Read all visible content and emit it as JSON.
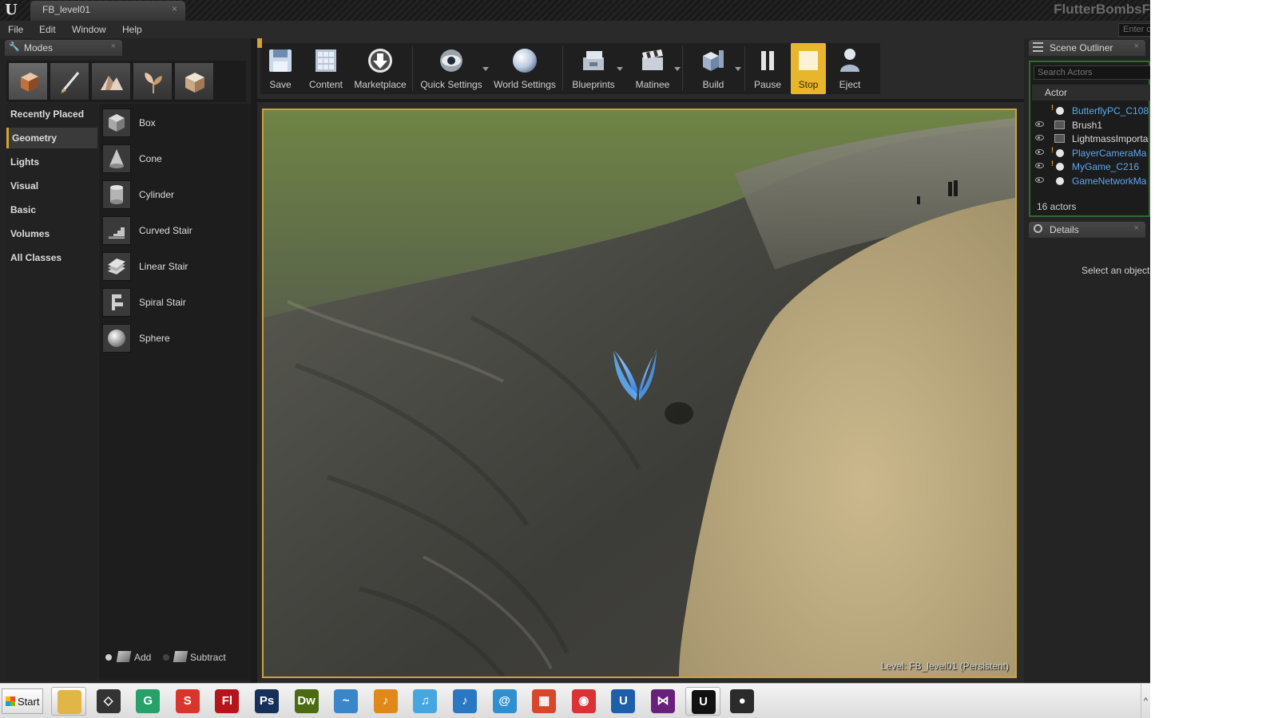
{
  "window": {
    "tab_title": "FB_level01",
    "tab_close": "×",
    "project_name": "FlutterBombsF",
    "help_search_placeholder": "Enter c"
  },
  "menubar": {
    "items": [
      "File",
      "Edit",
      "Window",
      "Help"
    ]
  },
  "modes_panel": {
    "tab_label": "Modes",
    "tab_close": "×",
    "tools": [
      {
        "icon": "place-mode-icon",
        "active": true
      },
      {
        "icon": "paint-mode-icon",
        "active": false
      },
      {
        "icon": "landscape-mode-icon",
        "active": false
      },
      {
        "icon": "foliage-mode-icon",
        "active": false
      },
      {
        "icon": "geometry-edit-mode-icon",
        "active": false
      }
    ],
    "categories": [
      {
        "label": "Recently Placed",
        "selected": false
      },
      {
        "label": "Geometry",
        "selected": true
      },
      {
        "label": "Lights",
        "selected": false
      },
      {
        "label": "Visual",
        "selected": false
      },
      {
        "label": "Basic",
        "selected": false
      },
      {
        "label": "Volumes",
        "selected": false
      },
      {
        "label": "All Classes",
        "selected": false
      }
    ],
    "items": [
      {
        "label": "Box",
        "icon": "box-icon"
      },
      {
        "label": "Cone",
        "icon": "cone-icon"
      },
      {
        "label": "Cylinder",
        "icon": "cylinder-icon"
      },
      {
        "label": "Curved Stair",
        "icon": "curved-stair-icon"
      },
      {
        "label": "Linear Stair",
        "icon": "linear-stair-icon"
      },
      {
        "label": "Spiral Stair",
        "icon": "spiral-stair-icon"
      },
      {
        "label": "Sphere",
        "icon": "sphere-icon"
      }
    ],
    "add_label": "Add",
    "subtract_label": "Subtract"
  },
  "toolbar": {
    "buttons": [
      {
        "label": "Save",
        "icon": "save-icon",
        "dropdown": false
      },
      {
        "label": "Content",
        "icon": "content-icon",
        "dropdown": false
      },
      {
        "label": "Marketplace",
        "icon": "marketplace-icon",
        "dropdown": false
      },
      {
        "label": "Quick Settings",
        "icon": "quick-settings-icon",
        "dropdown": true
      },
      {
        "label": "World Settings",
        "icon": "world-settings-icon",
        "dropdown": false
      },
      {
        "label": "Blueprints",
        "icon": "blueprints-icon",
        "dropdown": true
      },
      {
        "label": "Matinee",
        "icon": "matinee-icon",
        "dropdown": true
      },
      {
        "label": "Build",
        "icon": "build-icon",
        "dropdown": true
      },
      {
        "label": "Pause",
        "icon": "pause-icon",
        "dropdown": false
      },
      {
        "label": "Stop",
        "icon": "stop-icon",
        "dropdown": false
      },
      {
        "label": "Eject",
        "icon": "eject-icon",
        "dropdown": false
      }
    ]
  },
  "viewport": {
    "level_prefix": "Level:",
    "level_name": "FB_level01 (Persistent)"
  },
  "scene_outliner": {
    "tab_label": "Scene Outliner",
    "tab_close": "×",
    "search_placeholder": "Search Actors",
    "column_header": "Actor",
    "actors": [
      {
        "name": "ButterflyPC_C108",
        "style": "blue",
        "marker": true,
        "kind": "dot",
        "visible": false
      },
      {
        "name": "Brush1",
        "style": "white",
        "marker": false,
        "kind": "brush",
        "visible": true
      },
      {
        "name": "LightmassImporta",
        "style": "white",
        "marker": false,
        "kind": "brush",
        "visible": true
      },
      {
        "name": "PlayerCameraMa",
        "style": "blue",
        "marker": true,
        "kind": "dot",
        "visible": true
      },
      {
        "name": "MyGame_C216",
        "style": "blue",
        "marker": true,
        "kind": "dot",
        "visible": true
      },
      {
        "name": "GameNetworkMa",
        "style": "blue",
        "marker": false,
        "kind": "dot",
        "visible": true
      }
    ],
    "actor_count": "16 actors"
  },
  "details": {
    "tab_label": "Details",
    "tab_close": "×",
    "empty_message": "Select an object"
  },
  "taskbar": {
    "start_label": "Start",
    "apps": [
      {
        "name": "file-explorer-icon",
        "glyph": "",
        "color": "#e2b547",
        "open": true
      },
      {
        "name": "unity-icon",
        "glyph": "◇",
        "color": "#333333",
        "open": false
      },
      {
        "name": "gamemaker-icon",
        "glyph": "G",
        "color": "#27a06a",
        "open": false
      },
      {
        "name": "sketchup-icon",
        "glyph": "S",
        "color": "#d8362c",
        "open": false
      },
      {
        "name": "flash-icon",
        "glyph": "Fl",
        "color": "#b5141a",
        "open": false
      },
      {
        "name": "photoshop-icon",
        "glyph": "Ps",
        "color": "#16305a",
        "open": false
      },
      {
        "name": "dreamweaver-icon",
        "glyph": "Dw",
        "color": "#4a6b12",
        "open": false
      },
      {
        "name": "fish-app-icon",
        "glyph": "~",
        "color": "#3b86c8",
        "open": false
      },
      {
        "name": "audio-app-icon",
        "glyph": "♪",
        "color": "#e0891a",
        "open": false
      },
      {
        "name": "itunes-icon",
        "glyph": "♫",
        "color": "#46a7e0",
        "open": false
      },
      {
        "name": "media-player-icon",
        "glyph": "♪",
        "color": "#2a78c2",
        "open": false
      },
      {
        "name": "globe-app-icon",
        "glyph": "@",
        "color": "#2f8fcf",
        "open": false
      },
      {
        "name": "color-app-icon",
        "glyph": "▦",
        "color": "#d9472b",
        "open": false
      },
      {
        "name": "chrome-icon",
        "glyph": "◉",
        "color": "#db3236",
        "open": false
      },
      {
        "name": "unreal-engine-icon",
        "glyph": "U",
        "color": "#1d5fa8",
        "open": false
      },
      {
        "name": "visual-studio-icon",
        "glyph": "⋈",
        "color": "#68217a",
        "open": false
      },
      {
        "name": "unreal-editor-icon",
        "glyph": "U",
        "color": "#111111",
        "open": true
      },
      {
        "name": "obs-icon",
        "glyph": "●",
        "color": "#2b2b2b",
        "open": false
      }
    ],
    "tray_chevron": "^"
  },
  "colors": {
    "accent": "#d7a22d",
    "stop_highlight": "#e8b52b",
    "actor_link_blue": "#5aa8f0",
    "outliner_border": "#2f6b2f"
  }
}
